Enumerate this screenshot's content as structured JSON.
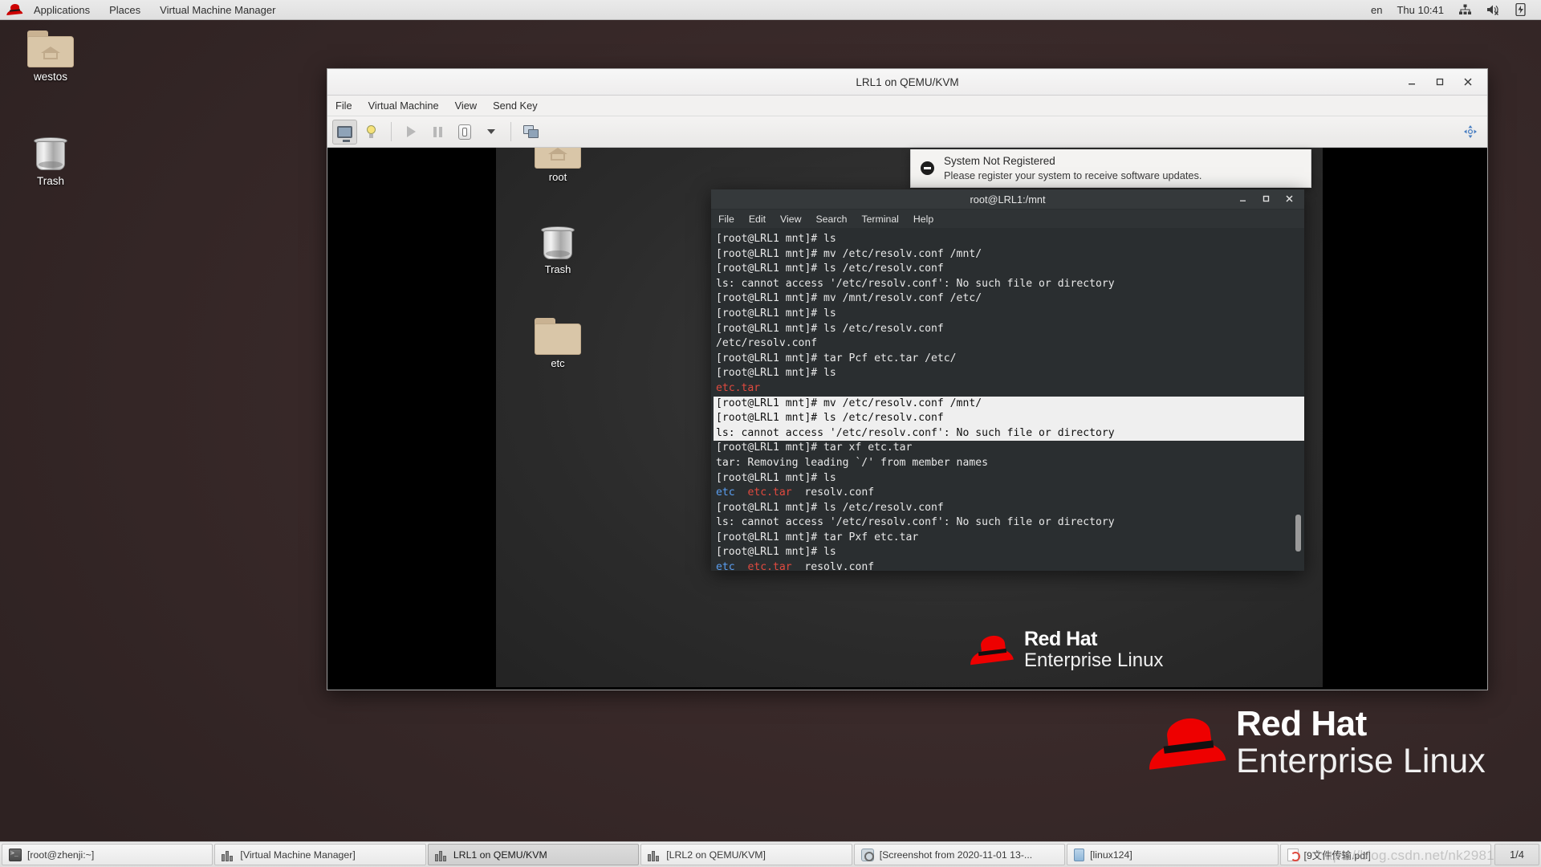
{
  "top_panel": {
    "logo": "redhat-logo-icon",
    "menus": [
      "Applications",
      "Places",
      "Virtual Machine Manager"
    ],
    "keyboard_layout": "en",
    "clock": "Thu 10:41",
    "tray_icons": [
      "network-icon",
      "volume-muted-icon",
      "battery-icon"
    ]
  },
  "host_desktop": {
    "icons": [
      {
        "label": "westos",
        "type": "home-folder-icon"
      },
      {
        "label": "Trash",
        "type": "trash-icon"
      }
    ],
    "branding": {
      "line1": "Red Hat",
      "line2": "Enterprise Linux"
    }
  },
  "vm_window": {
    "title": "LRL1 on QEMU/KVM",
    "menus": [
      "File",
      "Virtual Machine",
      "View",
      "Send Key"
    ],
    "window_buttons": {
      "minimize": "–",
      "maximize": "❐",
      "close": "✕"
    },
    "toolbar": [
      {
        "name": "show-console-button",
        "icon": "monitor-icon",
        "active": true
      },
      {
        "name": "show-details-button",
        "icon": "lightbulb-icon",
        "active": false
      },
      {
        "name": "run-button",
        "icon": "play-icon",
        "active": false
      },
      {
        "name": "pause-button",
        "icon": "pause-icon",
        "active": false
      },
      {
        "name": "shutdown-button",
        "icon": "power-icon",
        "active": false
      },
      {
        "name": "shutdown-menu-button",
        "icon": "chevron-down-icon",
        "active": false
      },
      {
        "name": "snapshots-button",
        "icon": "snapshot-icon",
        "active": false
      },
      {
        "name": "fullscreen-button",
        "icon": "fullscreen-icon",
        "active": false
      }
    ]
  },
  "guest_desktop": {
    "icons": [
      {
        "label": "root",
        "type": "home-folder-icon"
      },
      {
        "label": "Trash",
        "type": "trash-icon"
      },
      {
        "label": "etc",
        "type": "folder-icon"
      }
    ],
    "branding": {
      "line1": "Red Hat",
      "line2": "Enterprise Linux"
    }
  },
  "notification": {
    "icon": "blocked-icon",
    "title": "System Not Registered",
    "message": "Please register your system to receive software updates."
  },
  "terminal": {
    "title": "root@LRL1:/mnt",
    "menus": [
      "File",
      "Edit",
      "View",
      "Search",
      "Terminal",
      "Help"
    ],
    "window_buttons": {
      "minimize": "–",
      "maximize": "❐",
      "close": "✕"
    },
    "lines": [
      {
        "text": "[root@LRL1 mnt]# ls",
        "style": "normal"
      },
      {
        "text": "[root@LRL1 mnt]# mv /etc/resolv.conf /mnt/",
        "style": "normal"
      },
      {
        "text": "[root@LRL1 mnt]# ls /etc/resolv.conf",
        "style": "normal"
      },
      {
        "text": "ls: cannot access '/etc/resolv.conf': No such file or directory",
        "style": "normal"
      },
      {
        "text": "[root@LRL1 mnt]# mv /mnt/resolv.conf /etc/",
        "style": "normal"
      },
      {
        "text": "[root@LRL1 mnt]# ls",
        "style": "normal"
      },
      {
        "text": "[root@LRL1 mnt]# ls /etc/resolv.conf",
        "style": "normal"
      },
      {
        "text": "/etc/resolv.conf",
        "style": "normal"
      },
      {
        "text": "[root@LRL1 mnt]# tar Pcf etc.tar /etc/",
        "style": "normal"
      },
      {
        "text": "[root@LRL1 mnt]# ls",
        "style": "normal"
      },
      {
        "text": "etc.tar",
        "style": "red"
      },
      {
        "text": "[root@LRL1 mnt]# mv /etc/resolv.conf /mnt/",
        "style": "selected"
      },
      {
        "text": "[root@LRL1 mnt]# ls /etc/resolv.conf",
        "style": "selected"
      },
      {
        "text": "ls: cannot access '/etc/resolv.conf': No such file or directory",
        "style": "selected"
      },
      {
        "text": "[root@LRL1 mnt]# tar xf etc.tar",
        "style": "normal"
      },
      {
        "text": "tar: Removing leading `/' from member names",
        "style": "normal"
      },
      {
        "text": "[root@LRL1 mnt]# ls",
        "style": "normal"
      },
      {
        "text": "etc  etc.tar  resolv.conf",
        "style": "ls-colors"
      },
      {
        "text": "[root@LRL1 mnt]# ls /etc/resolv.conf",
        "style": "normal"
      },
      {
        "text": "ls: cannot access '/etc/resolv.conf': No such file or directory",
        "style": "normal"
      },
      {
        "text": "[root@LRL1 mnt]# tar Pxf etc.tar",
        "style": "normal"
      },
      {
        "text": "[root@LRL1 mnt]# ls",
        "style": "normal"
      },
      {
        "text": "etc  etc.tar  resolv.conf",
        "style": "ls-colors"
      }
    ],
    "ls_colors": {
      "dir": "#5a9ef0",
      "archive": "#e04a3f",
      "file": "#e8e8e8"
    }
  },
  "taskbar": {
    "items": [
      {
        "label": "[root@zhenji:~]",
        "icon": "terminal-icon",
        "active": false
      },
      {
        "label": "[Virtual Machine Manager]",
        "icon": "vmm-icon",
        "active": false
      },
      {
        "label": "LRL1 on QEMU/KVM",
        "icon": "vmm-icon",
        "active": true
      },
      {
        "label": "[LRL2 on QEMU/KVM]",
        "icon": "vmm-icon",
        "active": false
      },
      {
        "label": "[Screenshot from 2020-11-01 13-...",
        "icon": "screenshot-icon",
        "active": false
      },
      {
        "label": "[linux124]",
        "icon": "database-icon",
        "active": false
      },
      {
        "label": "[9文件传输.pdf]",
        "icon": "pdf-icon",
        "active": false
      }
    ],
    "workspace": "1/4"
  },
  "watermark": "https://blog.csdn.net/nk2981",
  "colors": {
    "accent_red": "#ee0000",
    "panel_bg": "#eaeaea",
    "terminal_bg": "#2a2e30",
    "selection_bg": "#efefef"
  }
}
